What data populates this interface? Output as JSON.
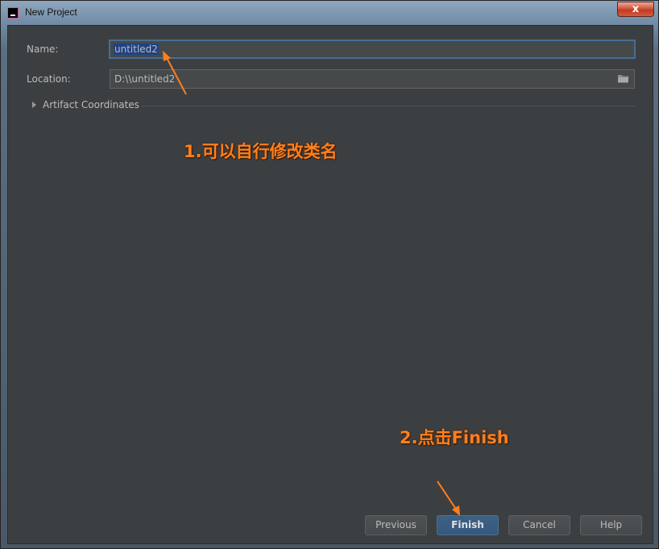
{
  "window": {
    "title": "New Project",
    "close_label": "x"
  },
  "form": {
    "name_label": "Name:",
    "name_value": "untitled2",
    "location_label": "Location:",
    "location_value": "D:\\\\untitled2",
    "artifact_label": "Artifact Coordinates"
  },
  "buttons": {
    "previous": "Previous",
    "finish": "Finish",
    "cancel": "Cancel",
    "help": "Help"
  },
  "annotations": {
    "note1": "1.可以自行修改类名",
    "note2": "2.点击Finish",
    "color": "#ff7f1e"
  },
  "icons": {
    "app": "intellij-icon",
    "browse": "folder-icon",
    "expand": "triangle-right-icon"
  },
  "colors": {
    "dialog_bg": "#3c3f41",
    "field_bg": "#45494a",
    "focus_border": "#466d94",
    "selection": "#214283",
    "default_button": "#365880"
  }
}
